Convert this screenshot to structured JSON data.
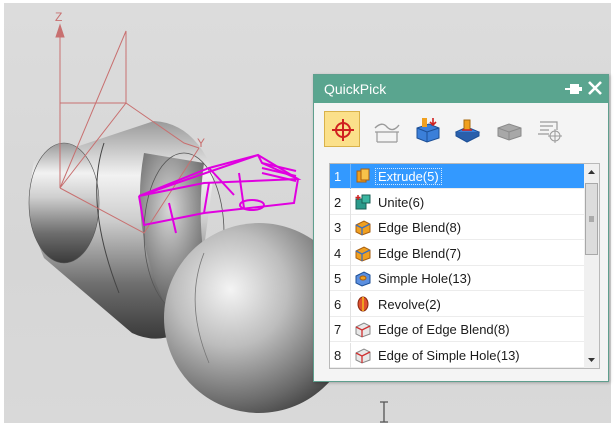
{
  "dialog": {
    "title": "QuickPick",
    "pin_icon": "pin-icon",
    "close_icon": "close-icon"
  },
  "toolbar": [
    {
      "icon": "all-selection-crosshair-icon",
      "active": true
    },
    {
      "icon": "curve-filter-icon",
      "active": false
    },
    {
      "icon": "body-feature-filter-icon",
      "active": false
    },
    {
      "icon": "face-feature-filter-icon",
      "active": false
    },
    {
      "icon": "solid-body-filter-icon",
      "active": false
    },
    {
      "icon": "datum-filter-icon",
      "active": false
    }
  ],
  "list": {
    "items": [
      {
        "number": "1",
        "label": "Extrude(5)",
        "icon": "extrude-icon",
        "selected": true
      },
      {
        "number": "2",
        "label": "Unite(6)",
        "icon": "unite-icon",
        "selected": false
      },
      {
        "number": "3",
        "label": "Edge Blend(8)",
        "icon": "edge-blend-icon",
        "selected": false
      },
      {
        "number": "4",
        "label": "Edge Blend(7)",
        "icon": "edge-blend-icon",
        "selected": false
      },
      {
        "number": "5",
        "label": "Simple Hole(13)",
        "icon": "simple-hole-icon",
        "selected": false
      },
      {
        "number": "6",
        "label": "Revolve(2)",
        "icon": "revolve-icon",
        "selected": false
      },
      {
        "number": "7",
        "label": "Edge of Edge Blend(8)",
        "icon": "edge-icon",
        "selected": false
      },
      {
        "number": "8",
        "label": "Edge of Simple Hole(13)",
        "icon": "edge-icon",
        "selected": false
      }
    ]
  },
  "viewport": {
    "axis_z": "Z",
    "axis_y": "Y",
    "highlight_color": "#e000e0",
    "axis_color": "#c87070"
  }
}
